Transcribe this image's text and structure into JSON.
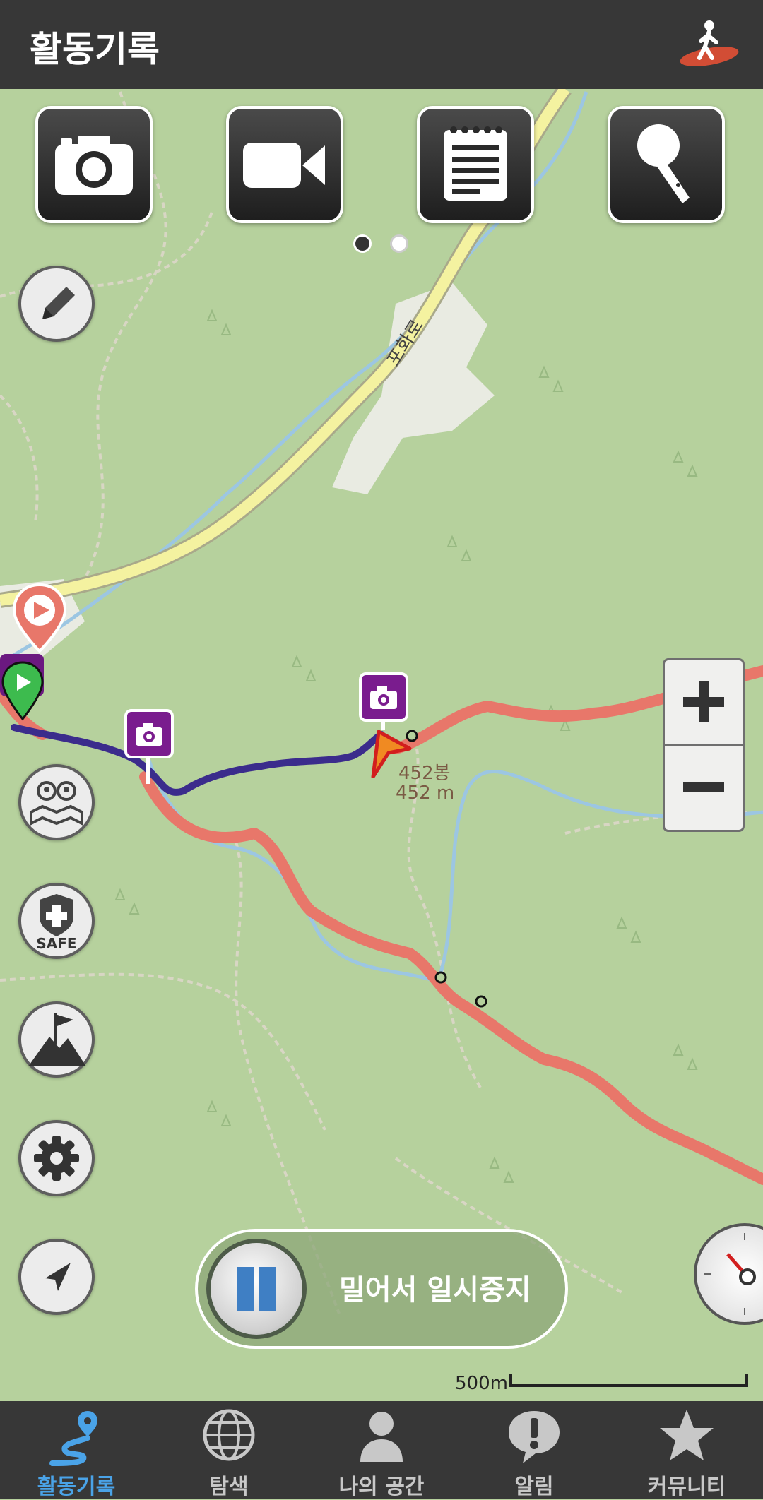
{
  "header": {
    "title": "활동기록",
    "activity_icon": "hiker-icon"
  },
  "quick_actions": [
    {
      "name": "camera",
      "icon": "camera-icon"
    },
    {
      "name": "video",
      "icon": "video-camera-icon"
    },
    {
      "name": "memo",
      "icon": "notepad-icon"
    },
    {
      "name": "voice",
      "icon": "microphone-icon"
    }
  ],
  "pager": {
    "total": 2,
    "current": 1
  },
  "side_tools": [
    {
      "name": "edit",
      "icon": "pencil-icon"
    },
    {
      "name": "people-map",
      "icon": "people-map-icon"
    },
    {
      "name": "safe",
      "icon": "safe-shield-icon",
      "label": "SAFE"
    },
    {
      "name": "summit",
      "icon": "mountain-flag-icon"
    },
    {
      "name": "settings",
      "icon": "gear-icon"
    },
    {
      "name": "my-location",
      "icon": "navigation-arrow-icon"
    }
  ],
  "map": {
    "road_label": "포화로",
    "peak_name": "452봉",
    "peak_elevation": "452 m",
    "scale_label": "500m",
    "colors": {
      "land": "#b6d19d",
      "road": "#f4f2a0",
      "track_recorded": "#3b2c8c",
      "track_planned": "#e8776a",
      "photo_pin": "#7a1c8e"
    }
  },
  "zoom": {
    "in_icon": "plus-icon",
    "out_icon": "minus-icon"
  },
  "pause_slider": {
    "label": "밀어서 일시중지",
    "icon": "pause-icon"
  },
  "bottom_nav": [
    {
      "label": "활동기록",
      "icon": "route-pin-icon",
      "active": true
    },
    {
      "label": "탐색",
      "icon": "globe-icon",
      "active": false
    },
    {
      "label": "나의 공간",
      "icon": "person-icon",
      "active": false
    },
    {
      "label": "알림",
      "icon": "alert-bubble-icon",
      "active": false
    },
    {
      "label": "커뮤니티",
      "icon": "star-icon",
      "active": false
    }
  ],
  "theme": {
    "nav_active": "#4aa3e8",
    "nav_inactive": "#c8c8c8",
    "header_bg": "#373737"
  }
}
